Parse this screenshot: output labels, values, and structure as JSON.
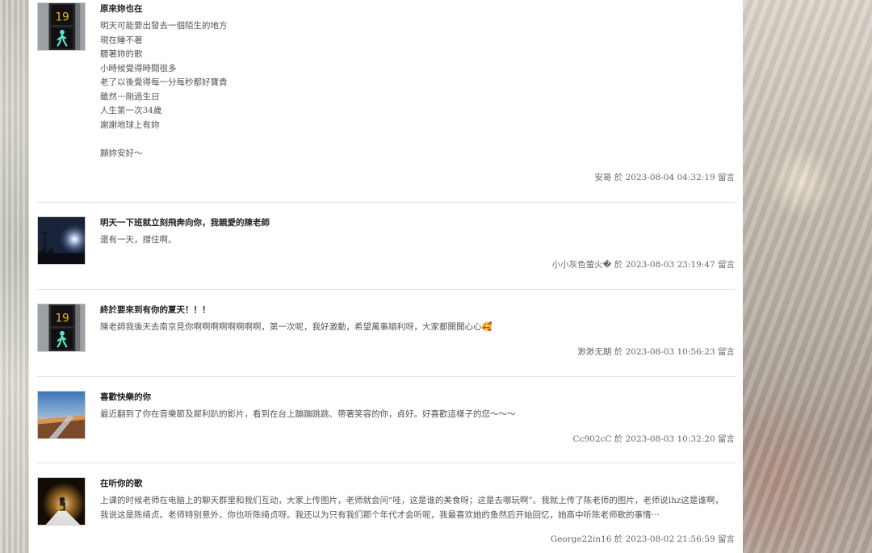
{
  "entries": [
    {
      "title": "原來妳也在",
      "lines": [
        "明天可能要出發去一個陌生的地方",
        "現在睡不著",
        "聽著妳的歌",
        "小時候覺得時間很多",
        "老了以後覺得每一分每秒都好寶貴",
        "雖然⋯剛過生日",
        "人生第一次34歲",
        "謝謝地球上有妳",
        "",
        "願妳安好～"
      ],
      "author": "安哥",
      "date": "2023-08-04 04:32:19",
      "avatar": "traffic-light-icon"
    },
    {
      "title": "明天一下班就立刻飛奔向你，我親愛的陳老師",
      "lines": [
        "還有一天，撐住啊。"
      ],
      "author": "小小灰色萤火�",
      "date": "2023-08-03 23:19:47",
      "avatar": "night-sky-photo"
    },
    {
      "title": "終於要來到有你的夏天！！！",
      "lines": [
        "陳老師我後天去南京見你啊啊啊啊啊啊啊啊，第一次呢，我好激動，希望萬事順利呀，大家都開開心心🥰"
      ],
      "author": "渺渺无期",
      "date": "2023-08-03 10:56:23",
      "avatar": "traffic-light-icon"
    },
    {
      "title": "喜歡快樂的你",
      "lines": [
        "最近翻到了你在音樂節及犀利趴的影片，看到在台上蹦蹦跳跳、帶著笑容的你，貞好。好喜歡這樣子的您～～～"
      ],
      "author": "Cc902cC",
      "date": "2023-08-03 10:32:20",
      "avatar": "sunset-wing-photo"
    },
    {
      "title": "在听你的歌",
      "lines": [
        "上课的时候老师在电脑上的聊天群里和我们互动，大家上传图片，老师就会问“哇，这是谁的美食呀；这是去哪玩啊”。我就上传了陈老师的图片，老师说lhz这是谁啊，我说这是陈绮贞。老师特别意外，你也听陈绮贞呀。我还以为只有我们那个年代才会听呢，我最喜欢她的鱼然后开始回忆，她高中听陈老师歌的事情⋯"
      ],
      "author": "George22in16",
      "date": "2023-08-02 21:56:59",
      "avatar": "stage-guitar-photo"
    }
  ],
  "meta_connector": "於",
  "meta_suffix": "留言",
  "colors": {
    "panel": "#ffffff",
    "title": "#222222",
    "body": "#555555",
    "meta": "#666666",
    "divider": "#e3e3e3"
  }
}
